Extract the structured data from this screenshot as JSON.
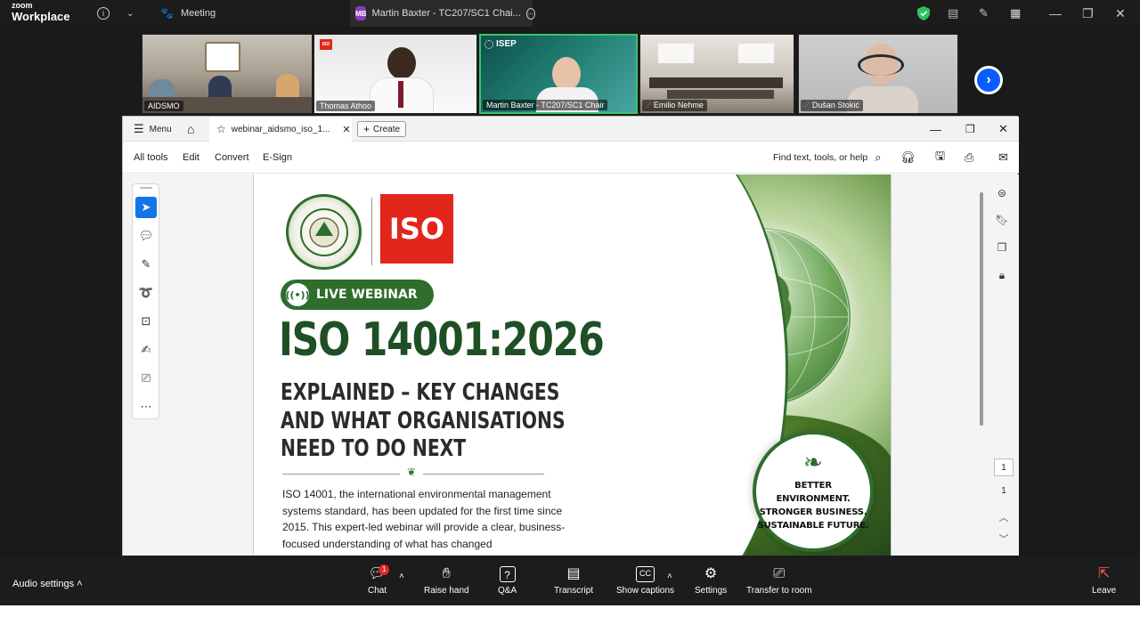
{
  "top_bar": {
    "logo_line1": "zoom",
    "logo_line2": "Workplace",
    "info_icon": "info-icon",
    "meeting_label": "Meeting",
    "speaker_initials": "MB",
    "speaker_title": "Martin Baxter - TC207/SC1 Chai...",
    "controls": {
      "minimize": "—",
      "restore": "❐",
      "close": "✕"
    }
  },
  "gallery": {
    "tiles": [
      {
        "name": "AIDSMO"
      },
      {
        "name": "Thomas Athoo"
      },
      {
        "name": "Martin Baxter - TC207/SC1 Chair"
      },
      {
        "name": "Emilio Nehme"
      },
      {
        "name": "Dušan Stokić"
      }
    ],
    "isep_label": "ISEP",
    "iso_small": "ISO"
  },
  "acrobat": {
    "menu_label": "Menu",
    "tab_title": "webinar_aidsmo_iso_1...",
    "create_label": "Create",
    "menubar": {
      "all_tools": "All tools",
      "edit": "Edit",
      "convert": "Convert",
      "esign": "E-Sign",
      "search_placeholder": "Find text, tools, or help"
    },
    "page_current": "1",
    "page_total": "1"
  },
  "pdf": {
    "iso_logo": "ISO",
    "live_label": "LIVE WEBINAR",
    "headline": "ISO 14001:2026",
    "subhead": [
      "EXPLAINED – KEY CHANGES",
      "AND WHAT ORGANISATIONS",
      "NEED TO DO NEXT"
    ],
    "body": "ISO 14001, the international environmental management systems standard, has been updated for the first time since 2015. This expert-led webinar will provide a clear, business-focused understanding of what has changed",
    "badge_lines": [
      "BETTER ENVIRONMENT.",
      "STRONGER BUSINESS.",
      "SUSTAINABLE FUTURE."
    ]
  },
  "bottom_bar": {
    "audio_settings": "Audio settings",
    "chat": "Chat",
    "chat_badge": "1",
    "raise_hand": "Raise hand",
    "qa": "Q&A",
    "transcript": "Transcript",
    "captions": "Show captions",
    "settings": "Settings",
    "transfer": "Transfer to room",
    "leave": "Leave"
  },
  "colors": {
    "accent_blue": "#0b5cff",
    "acrobat_blue": "#1473e6",
    "iso_red": "#e2261c",
    "brand_green": "#2f6d2c",
    "active_green": "#39c46b"
  }
}
